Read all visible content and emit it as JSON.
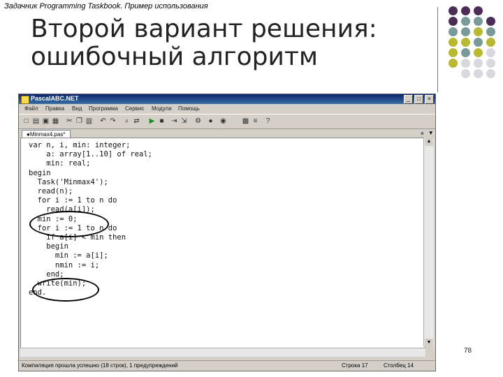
{
  "slide": {
    "caption": "Задачник Programming Taskbook. Пример использования",
    "title_line1": "Второй вариант решения:",
    "title_line2": "ошибочный алгоритм",
    "page_number": "78",
    "dot_colors": [
      "#4b2d57",
      "#7a9a9a",
      "#b8b833",
      "#d8d8de"
    ]
  },
  "ide": {
    "window_title": "PascalABC.NET",
    "menu": [
      "Файл",
      "Правка",
      "Вид",
      "Программа",
      "Сервис",
      "Модули",
      "Помощь"
    ],
    "tab_label": "●Minmax4.pas*",
    "code_lines": [
      "var n, i, min: integer;",
      "    a: array[1..10] of real;",
      "    min: real;",
      "begin",
      "  Task('Minmax4');",
      "  read(n);",
      "  for i := 1 to n do",
      "    read(a[i]);",
      "  min := 0;",
      "  for i := 1 to n do",
      "    if a[i] < min then",
      "    begin",
      "      min := a[i];",
      "      nmin := i;",
      "    end;",
      "  write(min);",
      "end."
    ],
    "status_message": "Компиляция прошла успешно (18 строк), 1 предупреждений",
    "status_row": "Строка 17",
    "status_col": "Столбец 14"
  }
}
